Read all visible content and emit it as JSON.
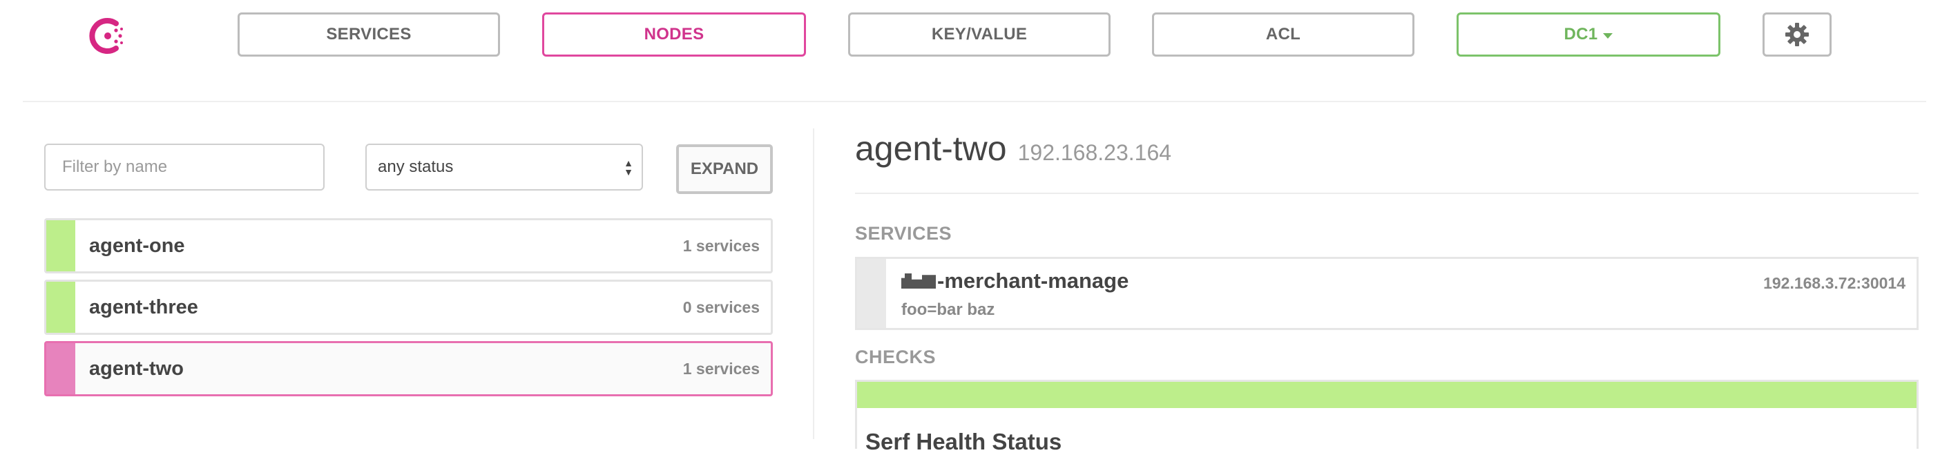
{
  "nav": {
    "services": "SERVICES",
    "nodes": "NODES",
    "keyvalue": "KEY/VALUE",
    "acl": "ACL",
    "datacenter": "DC1",
    "settings_icon": "gear-icon",
    "logo_icon": "consul-logo-icon"
  },
  "filters": {
    "name_placeholder": "Filter by name",
    "status_value": "any status",
    "expand_label": "EXPAND"
  },
  "nodes": [
    {
      "name": "agent-one",
      "services": "1 services",
      "status": "passing"
    },
    {
      "name": "agent-three",
      "services": "0 services",
      "status": "passing"
    },
    {
      "name": "agent-two",
      "services": "1 services",
      "status": "selected"
    }
  ],
  "detail": {
    "name": "agent-two",
    "address": "192.168.23.164",
    "services_heading": "SERVICES",
    "service": {
      "name_suffix": "-merchant-manage",
      "tags": "foo=bar baz",
      "address": "192.168.3.72:30014"
    },
    "checks_heading": "CHECKS",
    "check_name": "Serf Health Status"
  },
  "colors": {
    "accent_pink": "#e0479e",
    "dc_green": "#7cc36a",
    "passing_green": "#bdee8b"
  }
}
